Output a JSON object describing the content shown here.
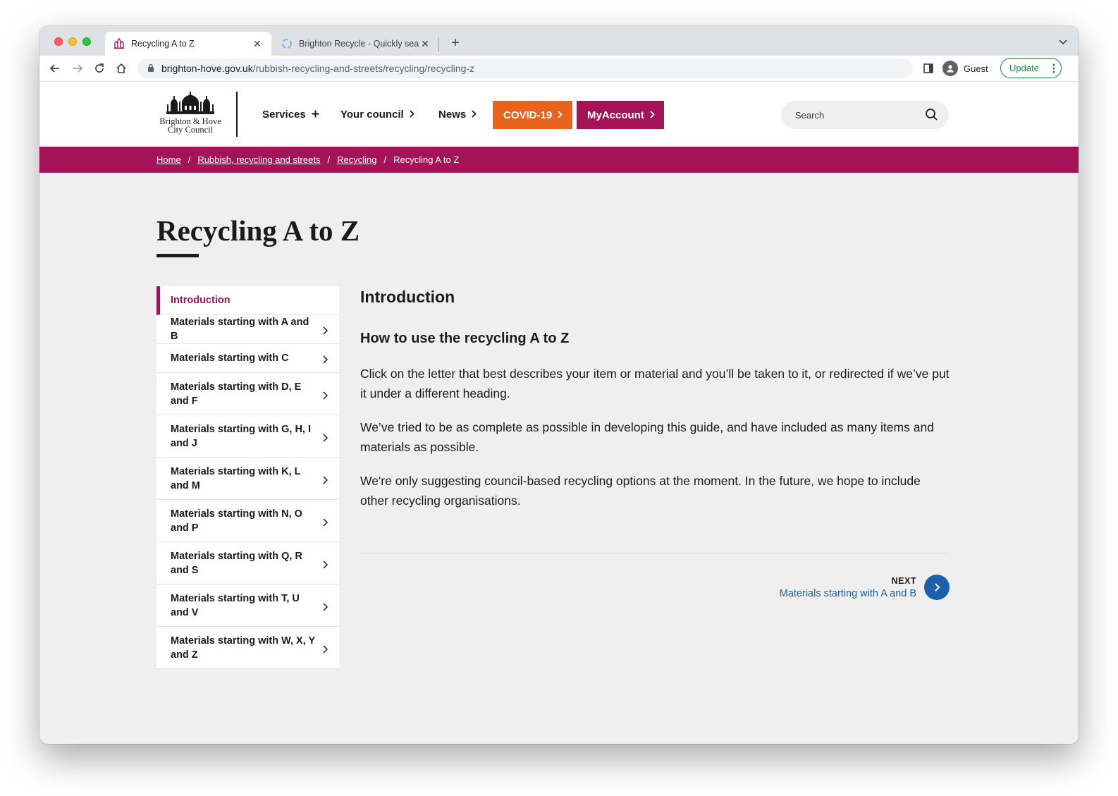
{
  "browser": {
    "tabs": [
      {
        "title": "Recycling A to Z",
        "active": true
      },
      {
        "title": "Brighton Recycle - Quickly sea",
        "active": false
      }
    ],
    "url_domain": "brighton-hove.gov.uk",
    "url_path": "/rubbish-recycling-and-streets/recycling/recycling-z",
    "profile_label": "Guest",
    "update_label": "Update"
  },
  "header": {
    "logo_line1": "Brighton & Hove",
    "logo_line2": "City Council",
    "nav": {
      "services": "Services",
      "your_council": "Your council",
      "news": "News",
      "covid": "COVID-19",
      "myaccount": "MyAccount"
    },
    "search_placeholder": "Search",
    "colors": {
      "covid": "#e8631c",
      "myaccount": "#a51257",
      "brand": "#a51257"
    }
  },
  "breadcrumb": {
    "home": "Home",
    "rubbish": "Rubbish, recycling and streets",
    "recycling": "Recycling",
    "current": "Recycling A to Z"
  },
  "page": {
    "title": "Recycling A to Z"
  },
  "sidebar": {
    "items": [
      {
        "label": "Introduction"
      },
      {
        "label": "Materials starting with A and B"
      },
      {
        "label": "Materials starting with C"
      },
      {
        "label": "Materials starting with D, E and F"
      },
      {
        "label": "Materials starting with G, H, I and J"
      },
      {
        "label": "Materials starting with K, L and M"
      },
      {
        "label": "Materials starting with N, O and P"
      },
      {
        "label": "Materials starting with Q, R and S"
      },
      {
        "label": "Materials starting with T, U and V"
      },
      {
        "label": "Materials starting with W, X, Y and Z"
      }
    ]
  },
  "content": {
    "section_title": "Introduction",
    "subheading": "How to use the recycling A to Z",
    "paragraphs": [
      "Click on the letter that best describes your item or material and you’ll be taken to it, or redirected if we’ve put it under a different heading.",
      "We’ve tried to be as complete as possible in developing this guide, and have included as many items and materials as possible.",
      "We're only suggesting council-based recycling options at the moment. In the future, we hope to include other recycling organisations."
    ],
    "next_label": "NEXT",
    "next_link": "Materials starting with A and B"
  }
}
